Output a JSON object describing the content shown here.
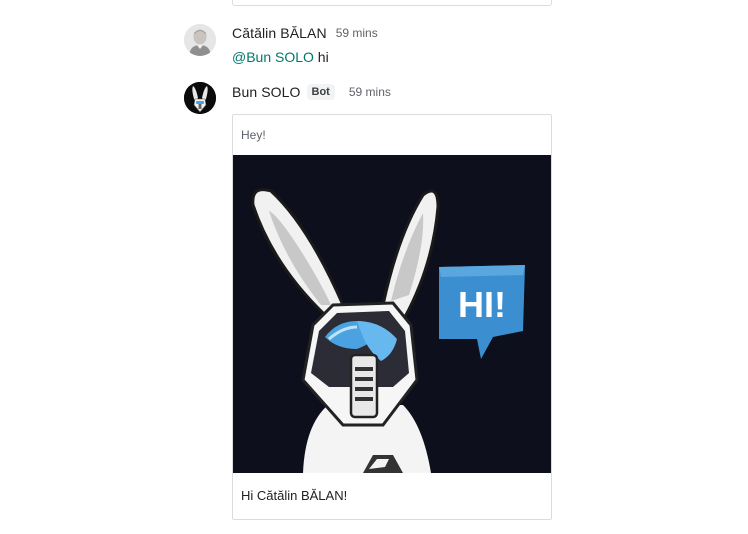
{
  "messages": [
    {
      "sender": "Cătălin BĂLAN",
      "time": "59 mins",
      "mention": "@Bun SOLO",
      "text": " hi"
    },
    {
      "sender": "Bun SOLO",
      "badge": "Bot",
      "time": "59 mins",
      "card": {
        "header": "Hey!",
        "image_text": "HI!",
        "footer": "Hi Cătălin BĂLAN!"
      }
    }
  ],
  "colors": {
    "mention": "#00796b",
    "speech_bubble": "#3b8fd1",
    "image_background": "#0e0f1c"
  },
  "icons": {
    "user_avatar": "person-photo",
    "bot_avatar": "robot-bunny",
    "card_image": "robot-bunny-saying-hi"
  }
}
